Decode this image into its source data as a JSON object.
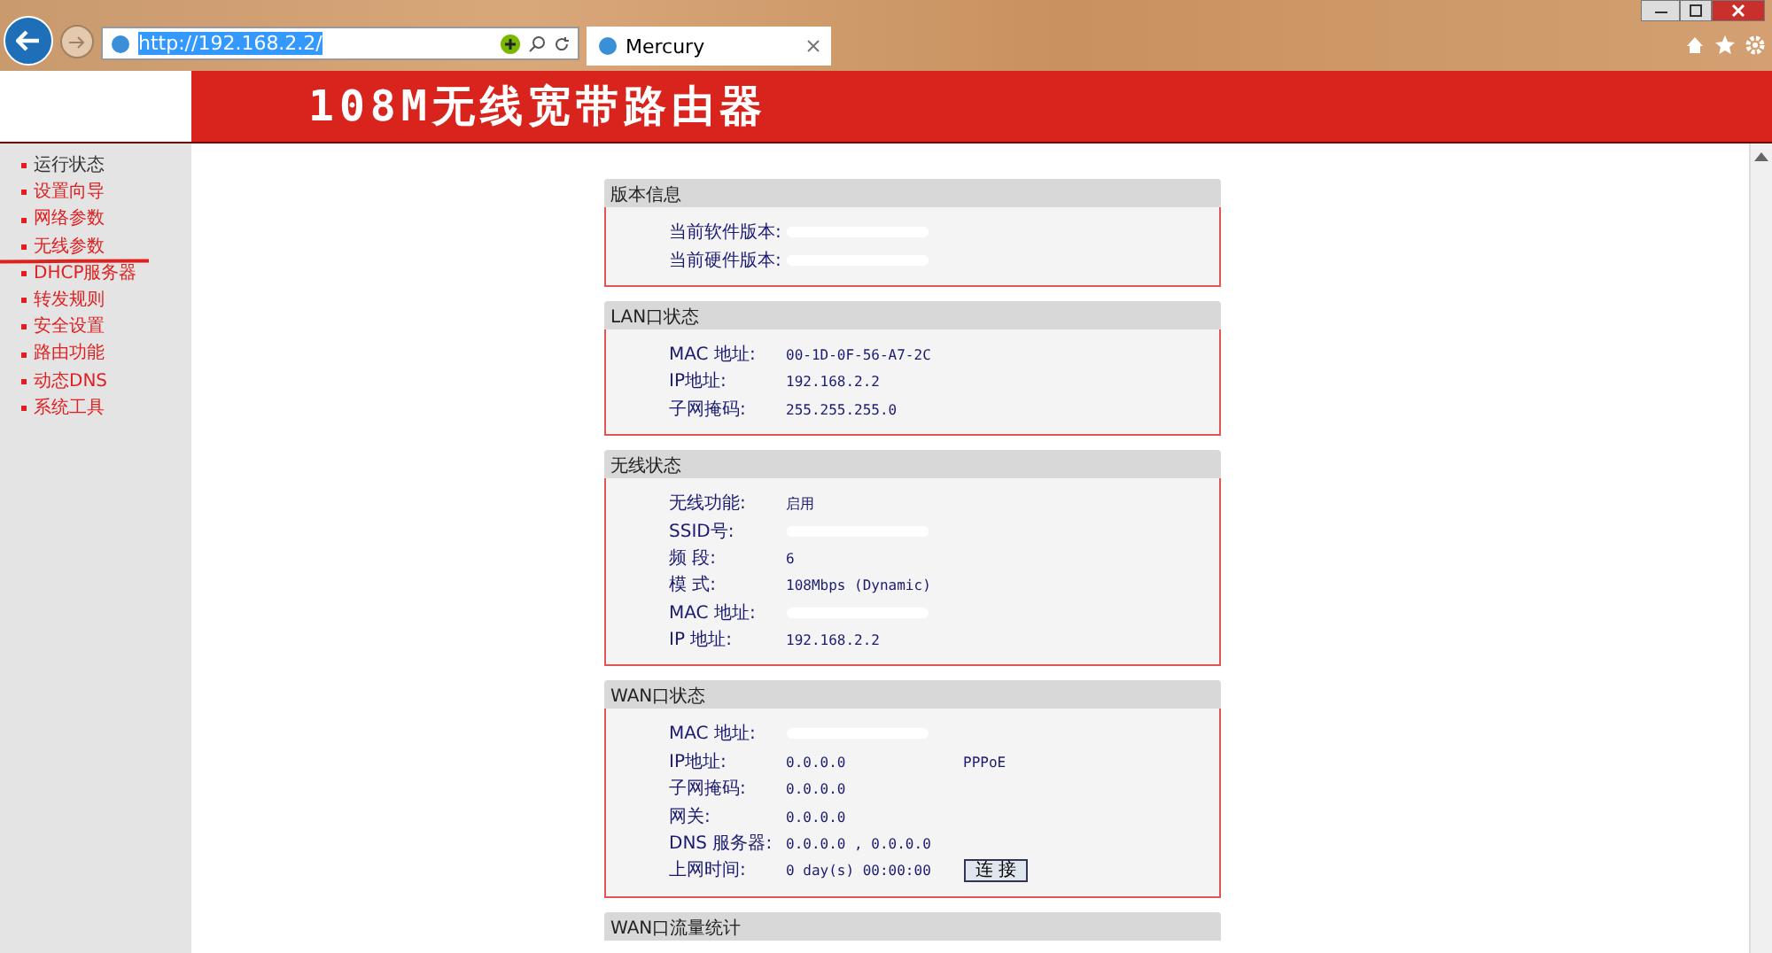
{
  "browser": {
    "url": "http://192.168.2.2/",
    "tabs": [
      {
        "title": "Mercury",
        "selected": true
      }
    ]
  },
  "banner": {
    "title": "108M无线宽带路由器"
  },
  "sidebar": {
    "items": [
      {
        "label": "运行状态",
        "selected": true
      },
      {
        "label": "设置向导",
        "selected": false
      },
      {
        "label": "网络参数",
        "selected": false
      },
      {
        "label": "无线参数",
        "selected": false
      },
      {
        "label": "DHCP服务器",
        "selected": false
      },
      {
        "label": "转发规则",
        "selected": false
      },
      {
        "label": "安全设置",
        "selected": false
      },
      {
        "label": "路由功能",
        "selected": false
      },
      {
        "label": "动态DNS",
        "selected": false
      },
      {
        "label": "系统工具",
        "selected": false
      }
    ]
  },
  "panels": [
    {
      "title": "版本信息",
      "rows": [
        {
          "label": "当前软件版本:"
        },
        {
          "label": "当前硬件版本:"
        }
      ]
    },
    {
      "title": "LAN口状态",
      "rows": [
        {
          "label": "MAC 地址:",
          "value": "00-1D-0F-56-A7-2C"
        },
        {
          "label": "IP地址:",
          "value": "192.168.2.2"
        },
        {
          "label": "子网掩码:",
          "value": "255.255.255.0"
        }
      ]
    },
    {
      "title": "无线状态",
      "rows": [
        {
          "label": "无线功能:",
          "value": "启用"
        },
        {
          "label": "SSID号:"
        },
        {
          "label": "频 段:",
          "value": "6"
        },
        {
          "label": "模 式:",
          "value": "108Mbps (Dynamic)"
        },
        {
          "label": "MAC 地址:"
        },
        {
          "label": "IP 地址:",
          "value": "192.168.2.2"
        }
      ]
    },
    {
      "title": "WAN口状态",
      "rows": [
        {
          "label": "MAC 地址:"
        },
        {
          "label": "IP地址:",
          "value": "0.0.0.0",
          "extra": "PPPoE"
        },
        {
          "label": "子网掩码:",
          "value": "0.0.0.0"
        },
        {
          "label": "网关:",
          "value": "0.0.0.0"
        },
        {
          "label": "DNS 服务器:",
          "value": "0.0.0.0 , 0.0.0.0"
        },
        {
          "label": "上网时间:",
          "value": "0 day(s) 00:00:00",
          "button": "连 接"
        }
      ]
    },
    {
      "title": "WAN口流量统计"
    }
  ]
}
